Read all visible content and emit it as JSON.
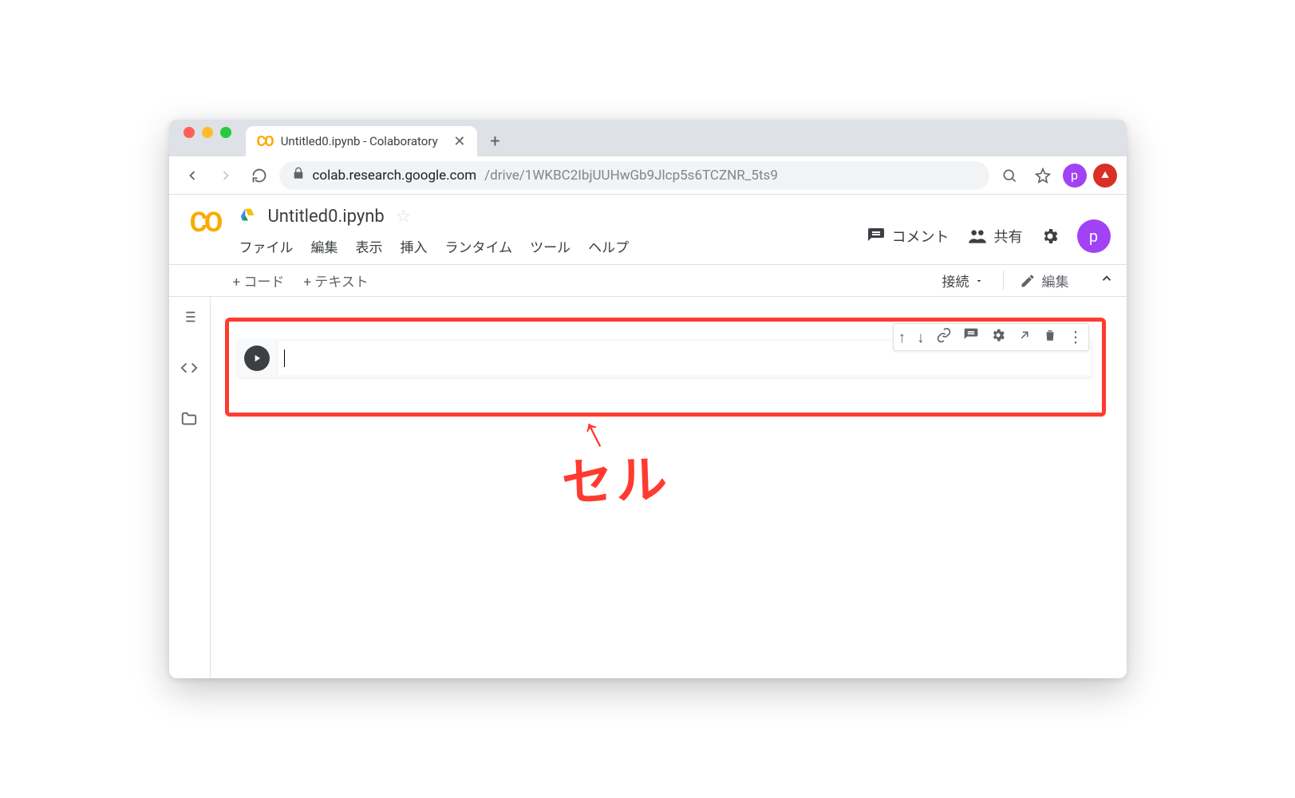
{
  "browser": {
    "tab_title": "Untitled0.ipynb - Colaboratory",
    "url_host": "colab.research.google.com",
    "url_path": "/drive/1WKBC2IbjUUHwGb9Jlcp5s6TCZNR_5ts9",
    "profile_initial": "p"
  },
  "header": {
    "doc_title": "Untitled0.ipynb",
    "comment_btn": "コメント",
    "share_btn": "共有",
    "profile_initial": "p"
  },
  "menubar": {
    "file": "ファイル",
    "edit": "編集",
    "view": "表示",
    "insert": "挿入",
    "runtime": "ランタイム",
    "tools": "ツール",
    "help": "ヘルプ"
  },
  "toolbar": {
    "add_code": "+ コード",
    "add_text": "+ テキスト",
    "connect": "接続",
    "editing": "編集"
  },
  "annotation": {
    "label": "セル",
    "arrow": "↑"
  }
}
